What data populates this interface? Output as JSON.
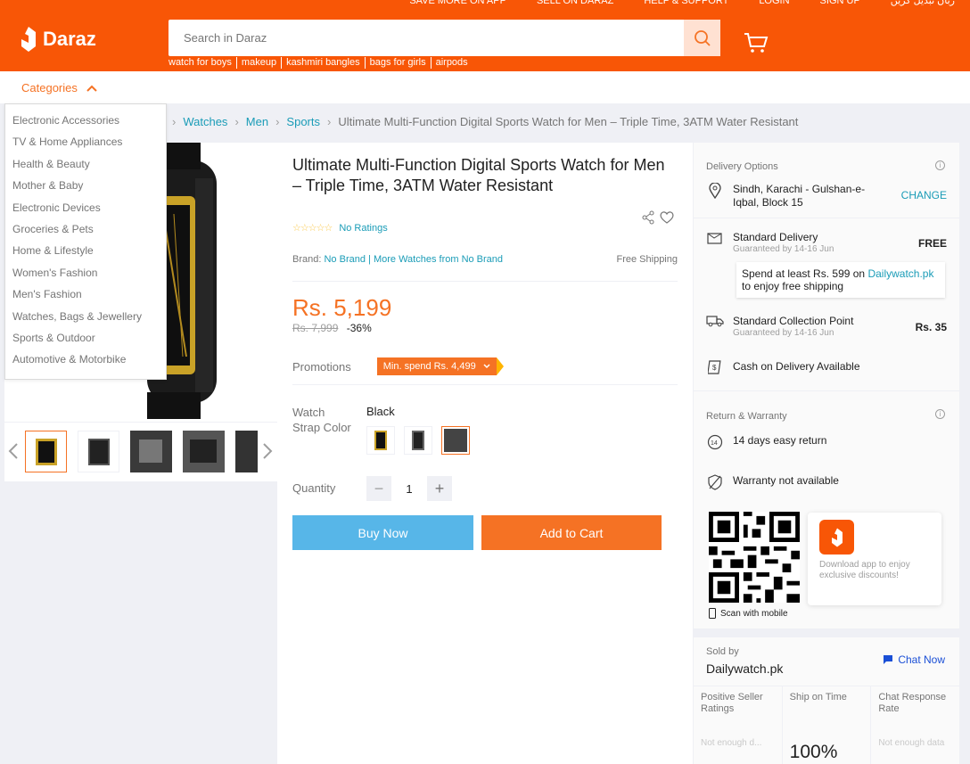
{
  "header": {
    "top_links": [
      "SAVE MORE ON APP",
      "SELL ON DARAZ",
      "HELP & SUPPORT",
      "LOGIN",
      "SIGN UP",
      "زبان تبدیل کریں"
    ],
    "logo_text": "Daraz",
    "search_placeholder": "Search in Daraz",
    "search_hints": [
      "watch for boys",
      "makeup",
      "kashmiri bangles",
      "bags for girls",
      "airpods"
    ],
    "brand_color": "#f85606"
  },
  "categories": {
    "label": "Categories",
    "items": [
      "Electronic Accessories",
      "TV & Home Appliances",
      "Health & Beauty",
      "Mother & Baby",
      "Electronic Devices",
      "Groceries & Pets",
      "Home & Lifestyle",
      "Women's Fashion",
      "Men's Fashion",
      "Watches, Bags & Jewellery",
      "Sports & Outdoor",
      "Automotive & Motorbike"
    ]
  },
  "breadcrumb": [
    "Watches",
    "Men",
    "Sports",
    "Ultimate Multi-Function Digital Sports Watch for Men – Triple Time, 3ATM Water Resistant"
  ],
  "product": {
    "title": "Ultimate Multi-Function Digital Sports Watch for Men – Triple Time, 3ATM Water Resistant",
    "rating_text": "No Ratings",
    "stars": "☆☆☆☆☆",
    "brand_label": "Brand:",
    "brand_value": "No Brand",
    "more_from": "More Watches from No Brand",
    "free_shipping": "Free Shipping",
    "price": "Rs. 5,199",
    "original_price": "Rs. 7,999",
    "discount": "-36%",
    "promotions_label": "Promotions",
    "promo_tag": "Min. spend Rs. 4,499",
    "variant_label": "Watch Strap Color",
    "variant_value": "Black",
    "quantity_label": "Quantity",
    "quantity": "1",
    "buy_now": "Buy Now",
    "add_to_cart": "Add to Cart"
  },
  "delivery": {
    "title": "Delivery Options",
    "address": "Sindh, Karachi - Gulshan-e-Iqbal, Block 15",
    "change": "CHANGE",
    "standard": "Standard Delivery",
    "standard_sub": "Guaranteed by 14-16 Jun",
    "standard_price": "FREE",
    "free_note_pre": "Spend at least Rs. 599 on ",
    "free_note_link": "Dailywatch.pk",
    "free_note_post": " to enjoy free shipping",
    "collection": "Standard Collection Point",
    "collection_sub": "Guaranteed by 14-16 Jun",
    "collection_price": "Rs. 35",
    "cod": "Cash on Delivery Available"
  },
  "warranty": {
    "title": "Return & Warranty",
    "return": "14 days easy return",
    "warranty": "Warranty not available"
  },
  "app": {
    "scan": "Scan with mobile",
    "download": "Download app to enjoy exclusive discounts!"
  },
  "seller": {
    "sold_by": "Sold by",
    "name": "Dailywatch.pk",
    "chat": "Chat Now",
    "stats": [
      {
        "label": "Positive Seller Ratings",
        "value": "Not enough d..."
      },
      {
        "label": "Ship on Time",
        "value": "100%"
      },
      {
        "label": "Chat Response Rate",
        "value": "Not enough data"
      }
    ]
  }
}
